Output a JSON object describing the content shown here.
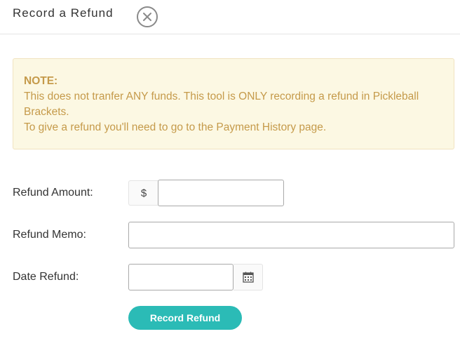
{
  "header": {
    "title": "Record a Refund",
    "close_icon": "close-circle-icon"
  },
  "note": {
    "heading": "NOTE:",
    "line1": "This does not tranfer ANY funds. This tool is ONLY recording a refund in Pickleball Brackets.",
    "line2": "To give a refund you'll need to go to the Payment History page."
  },
  "form": {
    "amount_label": "Refund Amount:",
    "currency_symbol": "$",
    "amount_value": "",
    "memo_label": "Refund Memo:",
    "memo_value": "",
    "date_label": "Date Refund:",
    "date_value": "",
    "calendar_icon": "calendar-icon",
    "submit_label": "Record Refund"
  },
  "colors": {
    "accent": "#2bbbb6",
    "note_background": "#fcf8e3",
    "note_text": "#c59a4a"
  }
}
